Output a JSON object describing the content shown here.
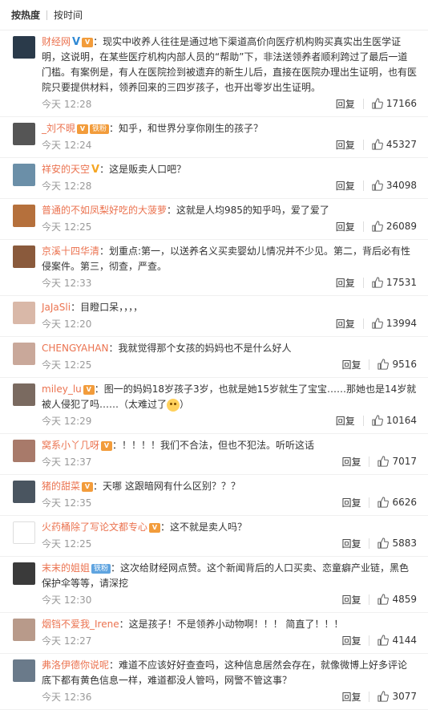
{
  "tabs": {
    "hot": "按热度",
    "time": "按时间"
  },
  "common": {
    "reply": "回复"
  },
  "comments": [
    {
      "user": "财经网",
      "badges": [
        "v-blue",
        "vip"
      ],
      "text": "：现实中收养人往往是通过地下渠道高价向医疗机构购买真实出生医学证明，这说明，在某些医疗机构内部人员的“帮助”下，非法送领养者顺利跨过了最后一道门槛。有案例是，有人在医院捡到被遗弃的新生儿后，直接在医院办理出生证明，也有医院只要提供材料，领养回来的三四岁孩子，也开出零岁出生证明。",
      "time": "今天 12:28",
      "likes": "17166",
      "avatar": "#2a3a4a"
    },
    {
      "user": "_刘不晛",
      "badges": [
        "vip",
        "tag-orange"
      ],
      "tag": "铁粉",
      "text": "：知乎，和世界分享你刚生的孩子？",
      "time": "今天 12:24",
      "likes": "45327",
      "avatar": "#555"
    },
    {
      "user": "祥安的天空",
      "badges": [
        "v-gold"
      ],
      "text": "：这是贩卖人口吧？",
      "time": "今天 12:28",
      "likes": "34098",
      "avatar": "#6b8fa8"
    },
    {
      "user": "普通的不如凤梨好吃的大菠萝",
      "badges": [],
      "text": "：这就是人均985的知乎吗，爱了爱了",
      "time": "今天 12:25",
      "likes": "26089",
      "avatar": "#b5703c"
    },
    {
      "user": "京溪十四华清",
      "badges": [],
      "text": "：划重点:第一，以送养名义买卖婴幼儿情况并不少见。第二，背后必有性侵案件。第三，彻查，严查。",
      "time": "今天 12:33",
      "likes": "17531",
      "avatar": "#8a5a3c"
    },
    {
      "user": "JaJaSli",
      "badges": [],
      "text": "：目瞪口呆，，，，",
      "time": "今天 12:20",
      "likes": "13994",
      "avatar": "#d9b8a8"
    },
    {
      "user": "CHENGYAHAN",
      "badges": [],
      "text": "：我就觉得那个女孩的妈妈也不是什么好人",
      "time": "今天 12:25",
      "likes": "9516",
      "avatar": "#c9a89a"
    },
    {
      "user": "miley_lu",
      "badges": [
        "vip"
      ],
      "text": "：图一的妈妈18岁孩子3岁，也就是她15岁就生了宝宝……那她也是14岁就被人侵犯了吗……（太难过了",
      "emoji": true,
      "text2": "）",
      "time": "今天 12:29",
      "likes": "10164",
      "avatar": "#7a6a60"
    },
    {
      "user": "窝系小丫几呀",
      "badges": [
        "vip"
      ],
      "text": "：！！！！我们不合法，但也不犯法。听听这话",
      "time": "今天 12:37",
      "likes": "7017",
      "avatar": "#a87a6a"
    },
    {
      "user": "猪的甜菜",
      "badges": [
        "vip"
      ],
      "text": "：天哪 这跟暗网有什么区别？？？",
      "time": "今天 12:35",
      "likes": "6626",
      "avatar": "#4a5560"
    },
    {
      "user": "火药桶除了写论文都专心",
      "badges": [
        "vip"
      ],
      "text": "：这不就是卖人吗？",
      "time": "今天 12:25",
      "likes": "5883",
      "avatar": "#ffffff"
    },
    {
      "user": "末末的姐姐",
      "badges": [
        "tag-blue"
      ],
      "tag": "铁粉",
      "text": "：这次给财经网点赞。这个新闻背后的人口买卖、恋童癖产业链，黑色保护伞等等，请深挖",
      "time": "今天 12:30",
      "likes": "4859",
      "avatar": "#3a3a3a"
    },
    {
      "user": "烟铛不爱我_Irene",
      "badges": [],
      "text": "：这是孩子！不是领养小动物啊！！！ 简直了！！！",
      "time": "今天 12:27",
      "likes": "4144",
      "avatar": "#b89a8a"
    },
    {
      "user": "弗洛伊德你说呢",
      "badges": [],
      "text": "：难道不应该好好查查吗，这种信息居然会存在，就像微博上好多评论底下都有黄色信息一样，难道都没人管吗，网警不管这事？",
      "time": "今天 12:36",
      "likes": "3077",
      "avatar": "#6a7a8a"
    }
  ]
}
